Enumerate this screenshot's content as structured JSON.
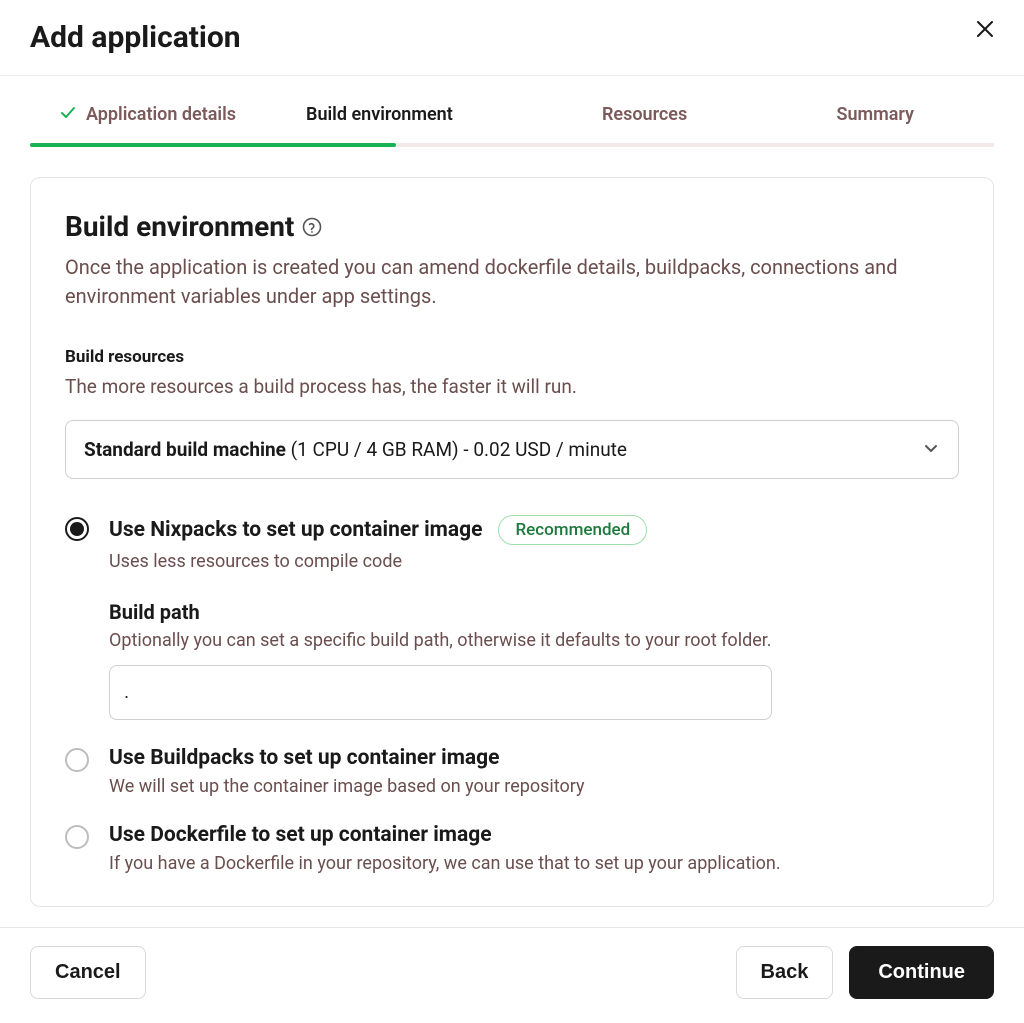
{
  "header": {
    "title": "Add application"
  },
  "stepper": {
    "steps": {
      "details": {
        "label": "Application details",
        "completed": true
      },
      "build": {
        "label": "Build environment",
        "active": true
      },
      "resources": {
        "label": "Resources"
      },
      "summary": {
        "label": "Summary"
      }
    }
  },
  "section": {
    "title": "Build environment",
    "description": "Once the application is created you can amend dockerfile details, buildpacks, connections and environment variables under app settings."
  },
  "build_resources": {
    "title": "Build resources",
    "description": "The more resources a build process has, the faster it will run.",
    "select": {
      "bold": "Standard build machine",
      "rest": " (1 CPU / 4 GB RAM) - 0.02 USD / minute"
    }
  },
  "options": {
    "nixpacks": {
      "title": "Use Nixpacks to set up container image",
      "badge": "Recommended",
      "description": "Uses less resources to compile code",
      "build_path": {
        "label": "Build path",
        "description": "Optionally you can set a specific build path, otherwise it defaults to your root folder.",
        "value": "."
      }
    },
    "buildpacks": {
      "title": "Use Buildpacks to set up container image",
      "description": "We will set up the container image based on your repository"
    },
    "dockerfile": {
      "title": "Use Dockerfile to set up container image",
      "description": "If you have a Dockerfile in your repository, we can use that to set up your application."
    }
  },
  "footer": {
    "cancel": "Cancel",
    "back": "Back",
    "continue": "Continue"
  }
}
